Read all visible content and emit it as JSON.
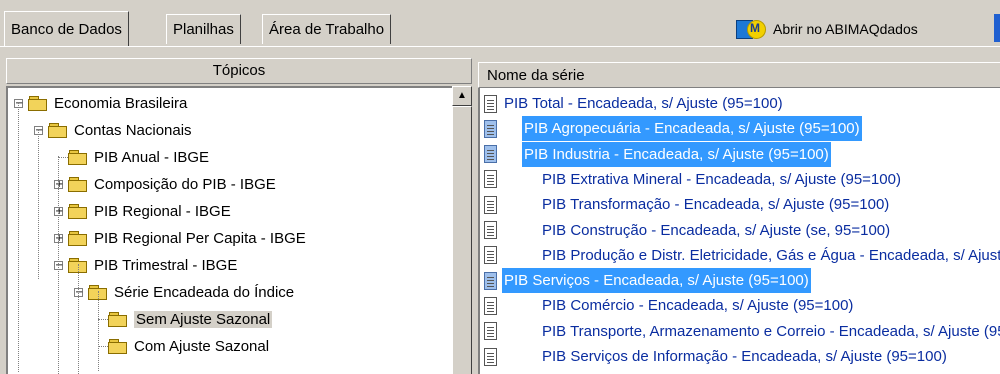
{
  "tabs": [
    {
      "label": "Banco de Dados",
      "active": true
    },
    {
      "label": "Planilhas",
      "active": false
    },
    {
      "label": "Área de Trabalho",
      "active": false
    }
  ],
  "toolbar": {
    "open_label": "Abrir no ABIMAQdados",
    "open_icon": "abimaq-logo-icon"
  },
  "left": {
    "header": "Tópicos",
    "tree": [
      {
        "label": "Economia Brasileira",
        "level": 0,
        "toggle": "−"
      },
      {
        "label": "Contas Nacionais",
        "level": 1,
        "toggle": "−"
      },
      {
        "label": "PIB Anual - IBGE",
        "level": 2,
        "toggle": ""
      },
      {
        "label": "Composição do PIB - IBGE",
        "level": 2,
        "toggle": "+"
      },
      {
        "label": "PIB Regional - IBGE",
        "level": 2,
        "toggle": "+"
      },
      {
        "label": "PIB Regional Per Capita - IBGE",
        "level": 2,
        "toggle": "+"
      },
      {
        "label": "PIB Trimestral - IBGE",
        "level": 2,
        "toggle": "−"
      },
      {
        "label": "Série Encadeada do Índice",
        "level": 3,
        "toggle": "−"
      },
      {
        "label": "Sem Ajuste Sazonal",
        "level": 4,
        "toggle": "",
        "selected": true
      },
      {
        "label": "Com Ajuste Sazonal",
        "level": 4,
        "toggle": ""
      }
    ]
  },
  "right": {
    "header": "Nome da série",
    "series": [
      {
        "label": "PIB Total - Encadeada, s/ Ajuste (95=100)",
        "level": 0,
        "highlighted": false
      },
      {
        "label": "PIB Agropecuária - Encadeada, s/ Ajuste (95=100)",
        "level": 1,
        "highlighted": true
      },
      {
        "label": "PIB Industria - Encadeada, s/ Ajuste (95=100)",
        "level": 1,
        "highlighted": true
      },
      {
        "label": "PIB Extrativa Mineral - Encadeada, s/ Ajuste (95=100)",
        "level": 2,
        "highlighted": false
      },
      {
        "label": "PIB Transformação - Encadeada, s/ Ajuste (95=100)",
        "level": 2,
        "highlighted": false
      },
      {
        "label": "PIB Construção - Encadeada, s/ Ajuste (se, 95=100)",
        "level": 2,
        "highlighted": false
      },
      {
        "label": "PIB Produção e Distr. Eletricidade, Gás e Água - Encadeada, s/ Ajuste (95=100)",
        "level": 2,
        "highlighted": false
      },
      {
        "label": "PIB Serviços - Encadeada, s/ Ajuste (95=100)",
        "level": 0,
        "highlighted": true
      },
      {
        "label": "PIB Comércio - Encadeada, s/ Ajuste (95=100)",
        "level": 2,
        "highlighted": false
      },
      {
        "label": "PIB Transporte, Armazenamento e Correio - Encadeada, s/ Ajuste (95=100)",
        "level": 2,
        "highlighted": false
      },
      {
        "label": "PIB Serviços de Informação - Encadeada, s/ Ajuste (95=100)",
        "level": 2,
        "highlighted": false
      }
    ]
  },
  "colors": {
    "highlight": "#3399ff",
    "series_text": "#0a2da0",
    "panel_bg": "#d4d0c8"
  }
}
